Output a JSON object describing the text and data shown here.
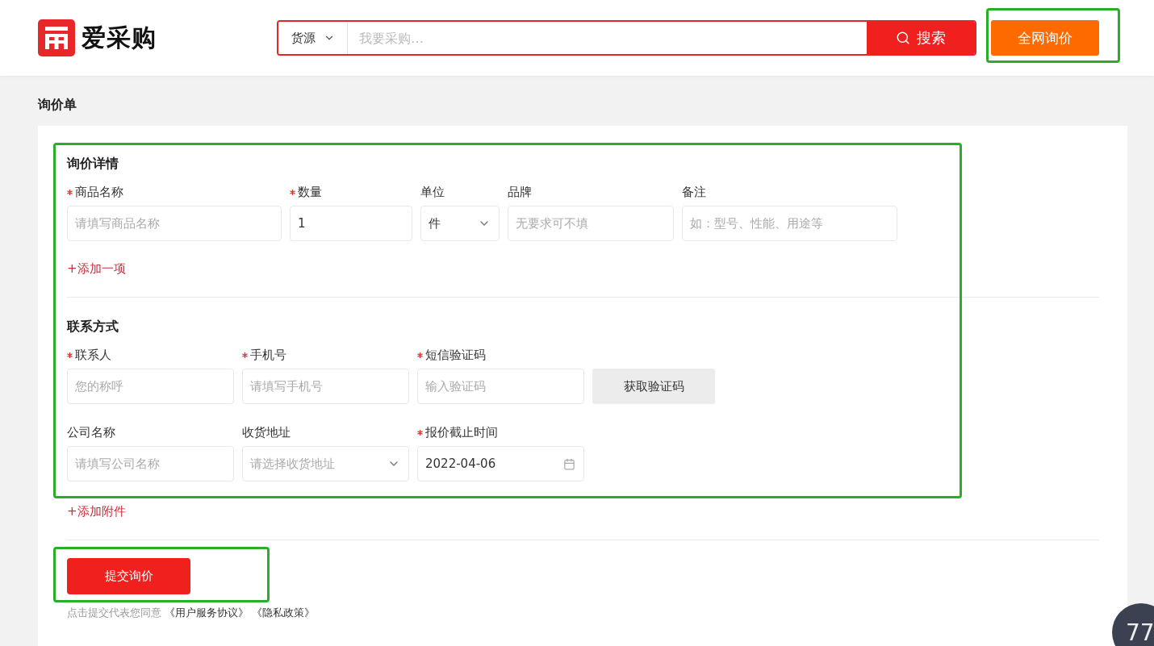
{
  "header": {
    "logo_text": "爱采购",
    "search": {
      "category": "货源",
      "placeholder": "我要采购…",
      "button": "搜索"
    },
    "inquiry_button": "全网询价"
  },
  "page_title": "询价单",
  "sections": [
    {
      "title": "询价详情",
      "rows": [
        [
          {
            "label": "商品名称",
            "required": true,
            "kind": "text",
            "placeholder": "请填写商品名称"
          },
          {
            "label": "数量",
            "required": true,
            "kind": "text",
            "value": "1"
          },
          {
            "label": "单位",
            "required": false,
            "kind": "select",
            "value": "件"
          },
          {
            "label": "品牌",
            "required": false,
            "kind": "text",
            "placeholder": "无要求可不填"
          },
          {
            "label": "备注",
            "required": false,
            "kind": "text",
            "placeholder": "如：型号、性能、用途等"
          }
        ]
      ],
      "add_link": "+添加一项"
    },
    {
      "title": "联系方式",
      "rows": [
        [
          {
            "label": "联系人",
            "required": true,
            "kind": "text",
            "placeholder": "您的称呼"
          },
          {
            "label": "手机号",
            "required": true,
            "kind": "text",
            "placeholder": "请填写手机号"
          },
          {
            "label": "短信验证码",
            "required": true,
            "kind": "text",
            "placeholder": "输入验证码"
          },
          {
            "kind": "button",
            "value": "获取验证码"
          }
        ],
        [
          {
            "label": "公司名称",
            "required": false,
            "kind": "text",
            "placeholder": "请填写公司名称"
          },
          {
            "label": "收货地址",
            "required": false,
            "kind": "select",
            "placeholder": "请选择收货地址"
          },
          {
            "label": "报价截止时间",
            "required": true,
            "kind": "date",
            "value": "2022-04-06"
          }
        ]
      ],
      "add_link": "+添加附件"
    }
  ],
  "submit_button": "提交询价",
  "agreement": {
    "text": "点击提交代表您同意",
    "links": [
      "《用户服务协议》",
      "《隐私政策》"
    ]
  },
  "score_widget": {
    "value": "77"
  }
}
